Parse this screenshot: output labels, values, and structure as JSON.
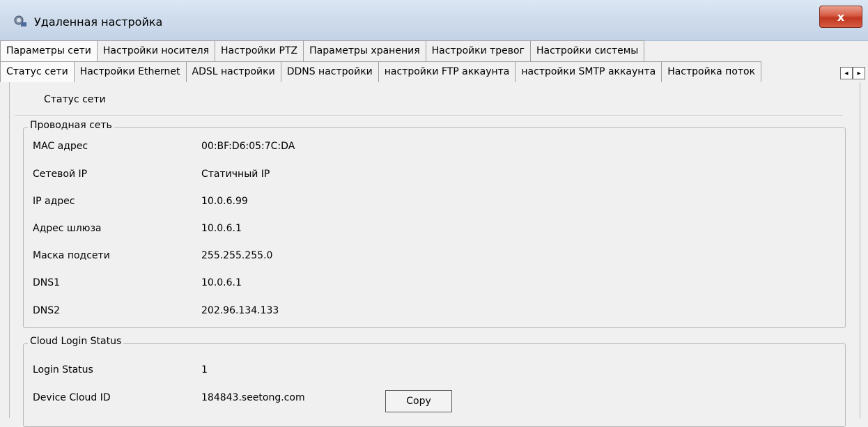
{
  "window": {
    "title": "Удаленная настройка",
    "close_label": "x"
  },
  "tabs_primary": [
    "Параметры сети",
    "Настройки носителя",
    "Настройки PTZ",
    "Параметры хранения",
    "Настройки тревог",
    "Настройки системы"
  ],
  "tabs_secondary": [
    "Статус сети",
    "Настройки Ethernet",
    "ADSL настройки",
    "DDNS настройки",
    "настройки FTP аккаунта",
    "настройки SMTP аккаунта",
    "Настройка поток"
  ],
  "section_title": "Статус сети",
  "wired": {
    "legend": "Проводная сеть",
    "rows": [
      {
        "label": "MAC адрес",
        "value": "00:BF:D6:05:7C:DA"
      },
      {
        "label": "Сетевой IP",
        "value": "Статичный IP"
      },
      {
        "label": "IP адрес",
        "value": "10.0.6.99"
      },
      {
        "label": "Адрес шлюза",
        "value": "10.0.6.1"
      },
      {
        "label": "Маска подсети",
        "value": "255.255.255.0"
      },
      {
        "label": "DNS1",
        "value": "10.0.6.1"
      },
      {
        "label": "DNS2",
        "value": "202.96.134.133"
      }
    ]
  },
  "cloud": {
    "legend": "Cloud Login Status",
    "rows": [
      {
        "label": "Login Status",
        "value": "1"
      },
      {
        "label": "Device Cloud ID",
        "value": "184843.seetong.com"
      }
    ],
    "copy_label": "Copy"
  },
  "icons": {
    "app": "network-settings-icon",
    "scroll_left": "◂",
    "scroll_right": "▸"
  }
}
